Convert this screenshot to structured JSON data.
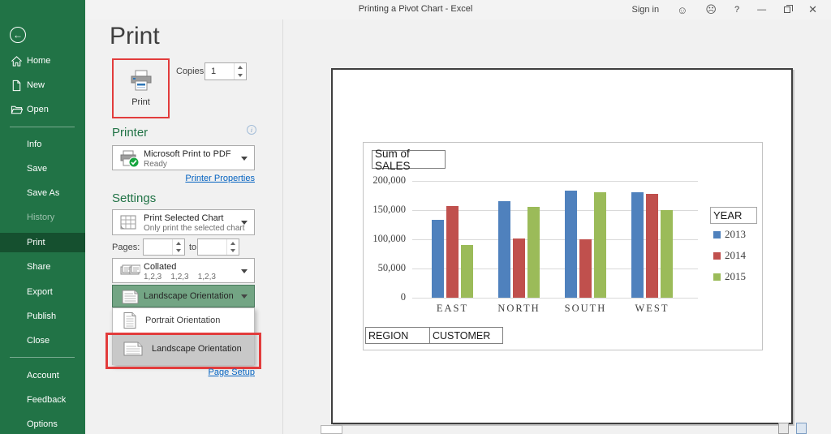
{
  "window": {
    "title": "Printing a Pivot Chart  -  Excel",
    "sign_in": "Sign in",
    "help": "?"
  },
  "sidebar": {
    "top": [
      "Home",
      "New",
      "Open"
    ],
    "middle": [
      "Info",
      "Save",
      "Save As",
      "History",
      "Print",
      "Share",
      "Export",
      "Publish",
      "Close"
    ],
    "bottom": [
      "Account",
      "Feedback",
      "Options"
    ]
  },
  "print_panel": {
    "heading": "Print",
    "print_button": "Print",
    "copies_label": "Copies:",
    "copies_value": "1",
    "printer_heading": "Printer",
    "printer_name": "Microsoft Print to PDF",
    "printer_status": "Ready",
    "printer_properties": "Printer Properties",
    "settings_heading": "Settings",
    "what_label": "Print Selected Chart",
    "what_sublabel": "Only print the selected chart",
    "pages_label": "Pages:",
    "pages_to": "to",
    "collation_label": "Collated",
    "collation_sublabel": "1,2,3    1,2,3    1,2,3",
    "orientation_selected": "Landscape Orientation",
    "orientation_options": [
      "Portrait Orientation",
      "Landscape Orientation"
    ],
    "page_setup": "Page Setup"
  },
  "preview": {
    "field_buttons": [
      "REGION",
      "CUSTOMER"
    ]
  },
  "chart_data": {
    "type": "bar",
    "title": "Sum of SALES",
    "categories": [
      "EAST",
      "NORTH",
      "SOUTH",
      "WEST"
    ],
    "series": [
      {
        "name": "2013",
        "color": "#4f81bd",
        "values": [
          134000,
          165000,
          183000,
          181000
        ]
      },
      {
        "name": "2014",
        "color": "#c0504d",
        "values": [
          157000,
          102000,
          100000,
          178000
        ]
      },
      {
        "name": "2015",
        "color": "#9bbb59",
        "values": [
          90000,
          155000,
          180000,
          150000
        ]
      }
    ],
    "xlabel": "",
    "ylabel": "",
    "ylim": [
      0,
      200000
    ],
    "ytick_step": 50000,
    "ytick_labels_top_to_bottom": [
      "200,000",
      "150,000",
      "100,000",
      "50,000",
      "0"
    ],
    "legend_title": "YEAR",
    "legend_position": "right",
    "grid": true
  },
  "colors": {
    "sidebar_green": "#217346",
    "selected_green": "#15502f",
    "heading_green": "#217346",
    "link_blue": "#0563c1",
    "highlight_red": "#e23c3c",
    "series_2013": "#4f81bd",
    "series_2014": "#c0504d",
    "series_2015": "#9bbb59"
  }
}
